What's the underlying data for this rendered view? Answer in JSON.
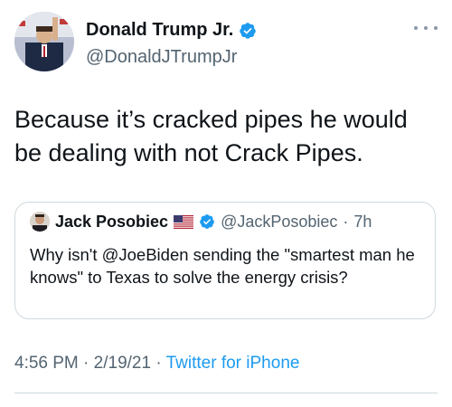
{
  "author": {
    "name": "Donald Trump Jr.",
    "handle": "@DonaldJTrumpJr",
    "avatar_icon": "profile-photo-icon",
    "verified_icon": "verified-badge-icon"
  },
  "more_icon": "more-options-icon",
  "tweet": {
    "text": "Because it’s cracked pipes he would be dealing with not Crack Pipes."
  },
  "quote": {
    "name": "Jack Posobiec",
    "flag_icon": "us-flag-icon",
    "handle": "@JackPosobiec",
    "sep": "·",
    "age": "7h",
    "text": "Why isn't @JoeBiden sending the \"smartest man he knows\" to Texas to solve the energy crisis?"
  },
  "meta": {
    "time": "4:56 PM",
    "sep1": "·",
    "date": "2/19/21",
    "sep2": "·",
    "source": "Twitter for iPhone"
  },
  "colors": {
    "verified": "#1d9bf0",
    "secondary_text": "#536471",
    "border": "#cfd9de"
  }
}
